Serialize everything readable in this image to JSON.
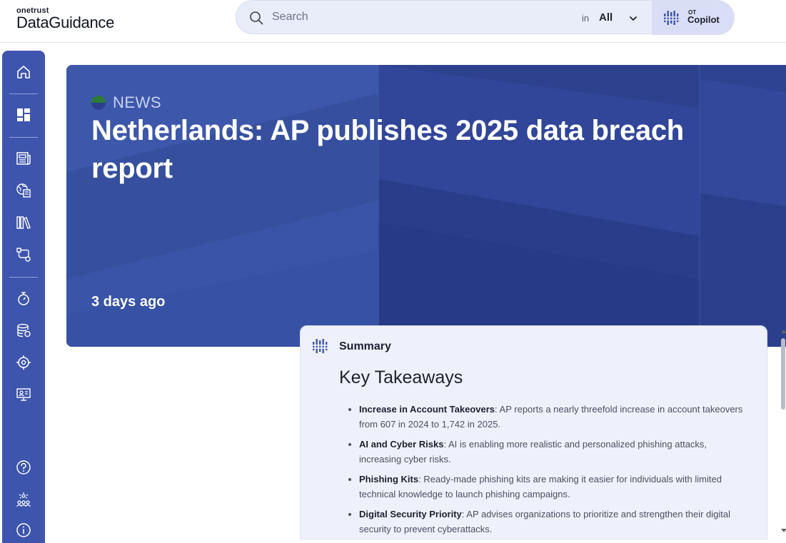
{
  "header": {
    "logo_small": "onetrust",
    "logo_big": "DataGuidance",
    "search_placeholder": "Search",
    "in_label": "in",
    "scope_value": "All",
    "copilot_ot": "OT",
    "copilot_label": "Copilot"
  },
  "sidebar": {
    "items": [
      {
        "id": "home",
        "icon": "home-icon"
      },
      {
        "id": "dashboard",
        "icon": "dashboard-icon"
      },
      {
        "id": "news",
        "icon": "newspaper-icon"
      },
      {
        "id": "jurisdictions",
        "icon": "globe-document-icon"
      },
      {
        "id": "library",
        "icon": "books-icon"
      },
      {
        "id": "workflows",
        "icon": "route-icon"
      },
      {
        "id": "timer",
        "icon": "stopwatch-icon"
      },
      {
        "id": "data",
        "icon": "database-icon"
      },
      {
        "id": "tracker",
        "icon": "target-icon"
      },
      {
        "id": "training",
        "icon": "presentation-icon"
      },
      {
        "id": "help",
        "icon": "help-icon"
      },
      {
        "id": "community",
        "icon": "community-icon"
      },
      {
        "id": "info",
        "icon": "info-icon"
      }
    ]
  },
  "hero": {
    "tag": "NEWS",
    "title": "Netherlands: AP publishes 2025 data breach report",
    "date": "3 days ago"
  },
  "summary": {
    "heading": "Summary",
    "title": "Key Takeaways",
    "items": [
      {
        "term": "Increase in Account Takeovers",
        "text": ": AP reports a nearly threefold increase in account takeovers from 607 in 2024 to 1,742 in 2025."
      },
      {
        "term": "AI and Cyber Risks",
        "text": ": AI is enabling more realistic and personalized phishing attacks, increasing cyber risks."
      },
      {
        "term": "Phishing Kits",
        "text": ": Ready-made phishing kits are making it easier for individuals with limited technical knowledge to launch phishing campaigns."
      },
      {
        "term": "Digital Security Priority",
        "text": ": AP advises organizations to prioritize and strengthen their digital security to prevent cyberattacks."
      }
    ]
  },
  "colors": {
    "brand": "#3e55ad",
    "hero": "#3a53a6",
    "summary_bg": "#eef0fb",
    "search_bg": "#e9ecf9"
  }
}
